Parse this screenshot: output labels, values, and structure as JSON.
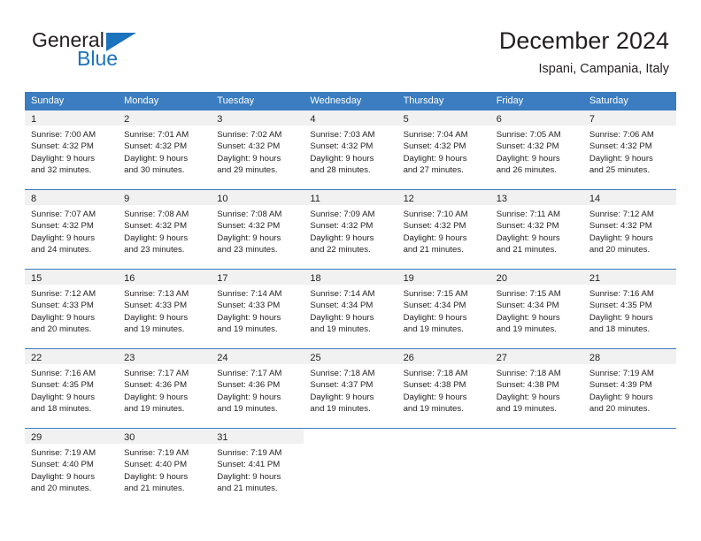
{
  "brand": {
    "name_top": "General",
    "name_bottom": "Blue",
    "accent_color": "#1b72bd"
  },
  "header": {
    "title": "December 2024",
    "subtitle": "Ispani, Campania, Italy"
  },
  "theme": {
    "header_bar_color": "#3b7dc0",
    "daynum_band_color": "#f1f1f1",
    "text_color": "#231f20"
  },
  "weekdays": [
    "Sunday",
    "Monday",
    "Tuesday",
    "Wednesday",
    "Thursday",
    "Friday",
    "Saturday"
  ],
  "weeks": [
    [
      {
        "day": "1",
        "sunrise": "Sunrise: 7:00 AM",
        "sunset": "Sunset: 4:32 PM",
        "daylight1": "Daylight: 9 hours",
        "daylight2": "and 32 minutes."
      },
      {
        "day": "2",
        "sunrise": "Sunrise: 7:01 AM",
        "sunset": "Sunset: 4:32 PM",
        "daylight1": "Daylight: 9 hours",
        "daylight2": "and 30 minutes."
      },
      {
        "day": "3",
        "sunrise": "Sunrise: 7:02 AM",
        "sunset": "Sunset: 4:32 PM",
        "daylight1": "Daylight: 9 hours",
        "daylight2": "and 29 minutes."
      },
      {
        "day": "4",
        "sunrise": "Sunrise: 7:03 AM",
        "sunset": "Sunset: 4:32 PM",
        "daylight1": "Daylight: 9 hours",
        "daylight2": "and 28 minutes."
      },
      {
        "day": "5",
        "sunrise": "Sunrise: 7:04 AM",
        "sunset": "Sunset: 4:32 PM",
        "daylight1": "Daylight: 9 hours",
        "daylight2": "and 27 minutes."
      },
      {
        "day": "6",
        "sunrise": "Sunrise: 7:05 AM",
        "sunset": "Sunset: 4:32 PM",
        "daylight1": "Daylight: 9 hours",
        "daylight2": "and 26 minutes."
      },
      {
        "day": "7",
        "sunrise": "Sunrise: 7:06 AM",
        "sunset": "Sunset: 4:32 PM",
        "daylight1": "Daylight: 9 hours",
        "daylight2": "and 25 minutes."
      }
    ],
    [
      {
        "day": "8",
        "sunrise": "Sunrise: 7:07 AM",
        "sunset": "Sunset: 4:32 PM",
        "daylight1": "Daylight: 9 hours",
        "daylight2": "and 24 minutes."
      },
      {
        "day": "9",
        "sunrise": "Sunrise: 7:08 AM",
        "sunset": "Sunset: 4:32 PM",
        "daylight1": "Daylight: 9 hours",
        "daylight2": "and 23 minutes."
      },
      {
        "day": "10",
        "sunrise": "Sunrise: 7:08 AM",
        "sunset": "Sunset: 4:32 PM",
        "daylight1": "Daylight: 9 hours",
        "daylight2": "and 23 minutes."
      },
      {
        "day": "11",
        "sunrise": "Sunrise: 7:09 AM",
        "sunset": "Sunset: 4:32 PM",
        "daylight1": "Daylight: 9 hours",
        "daylight2": "and 22 minutes."
      },
      {
        "day": "12",
        "sunrise": "Sunrise: 7:10 AM",
        "sunset": "Sunset: 4:32 PM",
        "daylight1": "Daylight: 9 hours",
        "daylight2": "and 21 minutes."
      },
      {
        "day": "13",
        "sunrise": "Sunrise: 7:11 AM",
        "sunset": "Sunset: 4:32 PM",
        "daylight1": "Daylight: 9 hours",
        "daylight2": "and 21 minutes."
      },
      {
        "day": "14",
        "sunrise": "Sunrise: 7:12 AM",
        "sunset": "Sunset: 4:32 PM",
        "daylight1": "Daylight: 9 hours",
        "daylight2": "and 20 minutes."
      }
    ],
    [
      {
        "day": "15",
        "sunrise": "Sunrise: 7:12 AM",
        "sunset": "Sunset: 4:33 PM",
        "daylight1": "Daylight: 9 hours",
        "daylight2": "and 20 minutes."
      },
      {
        "day": "16",
        "sunrise": "Sunrise: 7:13 AM",
        "sunset": "Sunset: 4:33 PM",
        "daylight1": "Daylight: 9 hours",
        "daylight2": "and 19 minutes."
      },
      {
        "day": "17",
        "sunrise": "Sunrise: 7:14 AM",
        "sunset": "Sunset: 4:33 PM",
        "daylight1": "Daylight: 9 hours",
        "daylight2": "and 19 minutes."
      },
      {
        "day": "18",
        "sunrise": "Sunrise: 7:14 AM",
        "sunset": "Sunset: 4:34 PM",
        "daylight1": "Daylight: 9 hours",
        "daylight2": "and 19 minutes."
      },
      {
        "day": "19",
        "sunrise": "Sunrise: 7:15 AM",
        "sunset": "Sunset: 4:34 PM",
        "daylight1": "Daylight: 9 hours",
        "daylight2": "and 19 minutes."
      },
      {
        "day": "20",
        "sunrise": "Sunrise: 7:15 AM",
        "sunset": "Sunset: 4:34 PM",
        "daylight1": "Daylight: 9 hours",
        "daylight2": "and 19 minutes."
      },
      {
        "day": "21",
        "sunrise": "Sunrise: 7:16 AM",
        "sunset": "Sunset: 4:35 PM",
        "daylight1": "Daylight: 9 hours",
        "daylight2": "and 18 minutes."
      }
    ],
    [
      {
        "day": "22",
        "sunrise": "Sunrise: 7:16 AM",
        "sunset": "Sunset: 4:35 PM",
        "daylight1": "Daylight: 9 hours",
        "daylight2": "and 18 minutes."
      },
      {
        "day": "23",
        "sunrise": "Sunrise: 7:17 AM",
        "sunset": "Sunset: 4:36 PM",
        "daylight1": "Daylight: 9 hours",
        "daylight2": "and 19 minutes."
      },
      {
        "day": "24",
        "sunrise": "Sunrise: 7:17 AM",
        "sunset": "Sunset: 4:36 PM",
        "daylight1": "Daylight: 9 hours",
        "daylight2": "and 19 minutes."
      },
      {
        "day": "25",
        "sunrise": "Sunrise: 7:18 AM",
        "sunset": "Sunset: 4:37 PM",
        "daylight1": "Daylight: 9 hours",
        "daylight2": "and 19 minutes."
      },
      {
        "day": "26",
        "sunrise": "Sunrise: 7:18 AM",
        "sunset": "Sunset: 4:38 PM",
        "daylight1": "Daylight: 9 hours",
        "daylight2": "and 19 minutes."
      },
      {
        "day": "27",
        "sunrise": "Sunrise: 7:18 AM",
        "sunset": "Sunset: 4:38 PM",
        "daylight1": "Daylight: 9 hours",
        "daylight2": "and 19 minutes."
      },
      {
        "day": "28",
        "sunrise": "Sunrise: 7:19 AM",
        "sunset": "Sunset: 4:39 PM",
        "daylight1": "Daylight: 9 hours",
        "daylight2": "and 20 minutes."
      }
    ],
    [
      {
        "day": "29",
        "sunrise": "Sunrise: 7:19 AM",
        "sunset": "Sunset: 4:40 PM",
        "daylight1": "Daylight: 9 hours",
        "daylight2": "and 20 minutes."
      },
      {
        "day": "30",
        "sunrise": "Sunrise: 7:19 AM",
        "sunset": "Sunset: 4:40 PM",
        "daylight1": "Daylight: 9 hours",
        "daylight2": "and 21 minutes."
      },
      {
        "day": "31",
        "sunrise": "Sunrise: 7:19 AM",
        "sunset": "Sunset: 4:41 PM",
        "daylight1": "Daylight: 9 hours",
        "daylight2": "and 21 minutes."
      },
      {
        "day": "",
        "sunrise": "",
        "sunset": "",
        "daylight1": "",
        "daylight2": ""
      },
      {
        "day": "",
        "sunrise": "",
        "sunset": "",
        "daylight1": "",
        "daylight2": ""
      },
      {
        "day": "",
        "sunrise": "",
        "sunset": "",
        "daylight1": "",
        "daylight2": ""
      },
      {
        "day": "",
        "sunrise": "",
        "sunset": "",
        "daylight1": "",
        "daylight2": ""
      }
    ]
  ]
}
